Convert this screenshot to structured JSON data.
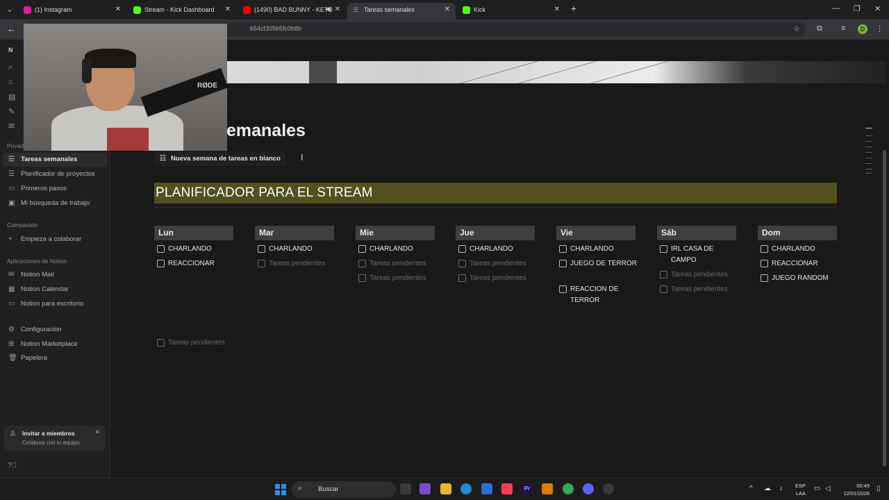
{
  "browser": {
    "tabs": [
      {
        "label": "(1) Instagram",
        "color": "#d6249f"
      },
      {
        "label": "Stream - Kick Dashboard",
        "color": "#53fc18"
      },
      {
        "label": "(1490) BAD BUNNY - KETU",
        "color": "#ff0000"
      },
      {
        "label": "Tareas semanales",
        "color": "#9b9b9b"
      },
      {
        "label": "Kick",
        "color": "#53fc18"
      }
    ],
    "new_tab": "+",
    "url": "b54cf305b5fc0b8b",
    "profile_initial": "D"
  },
  "sidebar": {
    "workspace_initial": "N",
    "section_private": "Privad",
    "private_items": [
      {
        "label": "Tareas semanales",
        "icon": "list-icon"
      },
      {
        "label": "Planificador de proyectos",
        "icon": "list-icon"
      },
      {
        "label": "Primeros pasos",
        "icon": "doc-icon"
      },
      {
        "label": "Mi búsqueda de trabajo",
        "icon": "briefcase-icon"
      }
    ],
    "section_shared": "Compartido",
    "shared_items": [
      {
        "label": "Empieza a colaborar",
        "icon": "plus-icon"
      }
    ],
    "section_apps": "Aplicaciones de Notion",
    "app_items": [
      {
        "label": "Notion Mail",
        "icon": "mail-icon"
      },
      {
        "label": "Notion Calendar",
        "icon": "calendar-icon"
      },
      {
        "label": "Notion para escritorio",
        "icon": "desktop-icon"
      }
    ],
    "bottom_items": [
      {
        "label": "Configuración",
        "icon": "gear-icon"
      },
      {
        "label": "Notion Marketplace",
        "icon": "store-icon"
      },
      {
        "label": "Papelera",
        "icon": "trash-icon"
      }
    ],
    "invite": {
      "title": "Invitar a miembros",
      "subtitle": "Colabora con tu equipo."
    }
  },
  "page": {
    "title": "emanales",
    "new_week_button": "Nueva semana de tareas en blanco",
    "banner": "PLANIFICADOR PARA EL STREAM",
    "banner_color": "#53501f",
    "days": [
      {
        "name": "Lun",
        "tasks": [
          {
            "text": "CHARLANDO",
            "pending": false
          },
          {
            "text": "REACCIONAR",
            "pending": false
          }
        ]
      },
      {
        "name": "Mar",
        "tasks": [
          {
            "text": "CHARLANDO",
            "pending": false
          },
          {
            "text": "Tareas pendientes",
            "pending": true
          }
        ]
      },
      {
        "name": "Mie",
        "tasks": [
          {
            "text": "CHARLANDO",
            "pending": false
          },
          {
            "text": "Tareas pendientes",
            "pending": true
          },
          {
            "text": "Tareas pendientes",
            "pending": true
          }
        ]
      },
      {
        "name": "Jue",
        "tasks": [
          {
            "text": "CHARLANDO",
            "pending": false
          },
          {
            "text": "Tareas pendientes",
            "pending": true
          },
          {
            "text": "Tareas pendientes",
            "pending": true
          }
        ]
      },
      {
        "name": "Vie",
        "tasks": [
          {
            "text": "CHARLANDO",
            "pending": false
          },
          {
            "text": "JUEGO DE TERROR",
            "pending": false
          },
          {
            "text": "REACCION DE TERROR",
            "pending": false
          }
        ]
      },
      {
        "name": "Sáb",
        "tasks": [
          {
            "text": "IRL CASA DE CAMPO",
            "pending": false
          },
          {
            "text": "Tareas pendientes",
            "pending": true
          },
          {
            "text": "Tareas pendientes",
            "pending": true
          }
        ]
      },
      {
        "name": "Dom",
        "tasks": [
          {
            "text": "CHARLANDO",
            "pending": false
          },
          {
            "text": "REACCIONAR",
            "pending": false
          },
          {
            "text": "JUEGO RANDOM",
            "pending": false
          }
        ]
      }
    ],
    "extra_task": "Tareas pendientes"
  },
  "webcam": {
    "mic_brand": "RØDE"
  },
  "taskbar": {
    "search_label": "Buscar",
    "lang_top": "ESP",
    "lang_bottom": "LAA",
    "time": "00:49",
    "date": "12/01/2026"
  }
}
